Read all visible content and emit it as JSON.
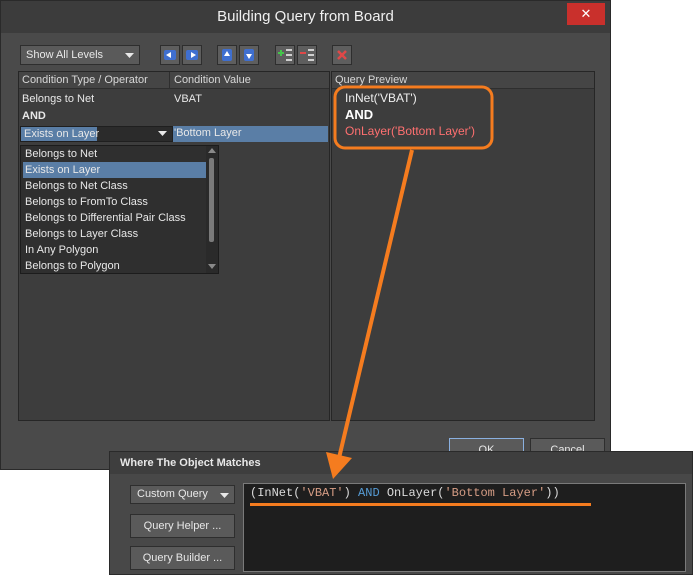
{
  "dialog": {
    "title": "Building Query from Board",
    "close_glyph": "✕",
    "toolbar": {
      "levels_dropdown": "Show All Levels",
      "icons": [
        "arrow-left-icon",
        "arrow-right-icon",
        "arrow-up-icon",
        "arrow-down-icon",
        "add-row-icon",
        "remove-row-icon",
        "delete-icon"
      ]
    },
    "conditions": {
      "col_type": "Condition Type / Operator",
      "col_value": "Condition Value",
      "rows": [
        {
          "type": "Belongs to Net",
          "value": "VBAT"
        },
        {
          "type": "AND",
          "value": ""
        },
        {
          "type": "Exists on Layer",
          "value": "'Bottom Layer"
        }
      ],
      "dropdown_options": [
        "Belongs to Net",
        "Exists on Layer",
        "Belongs to Net Class",
        "Belongs to FromTo Class",
        "Belongs to Differential Pair Class",
        "Belongs to Layer Class",
        "In Any Polygon",
        "Belongs to Polygon"
      ],
      "selected_option": "Exists on Layer"
    },
    "preview": {
      "header": "Query Preview",
      "line1": "InNet('VBAT')",
      "line2": "AND",
      "line3": "OnLayer('Bottom Layer')"
    },
    "ok_label": "OK",
    "cancel_label": "Cancel"
  },
  "where_panel": {
    "title": "Where The Object Matches",
    "custom_query": "Custom Query",
    "query_helper": "Query Helper ...",
    "query_builder": "Query Builder ...",
    "query": {
      "open": "(InNet(",
      "arg1": "'VBAT'",
      "close1": ")",
      "op": "AND",
      "fn2": "OnLayer(",
      "arg2": "'Bottom Layer'",
      "close2": "))"
    }
  },
  "colors": {
    "annotation": "#f57c1f",
    "selection": "#5a7ea6",
    "preview_red": "#ff7070",
    "string_color": "#d69d85",
    "keyword_color": "#569cd6"
  }
}
